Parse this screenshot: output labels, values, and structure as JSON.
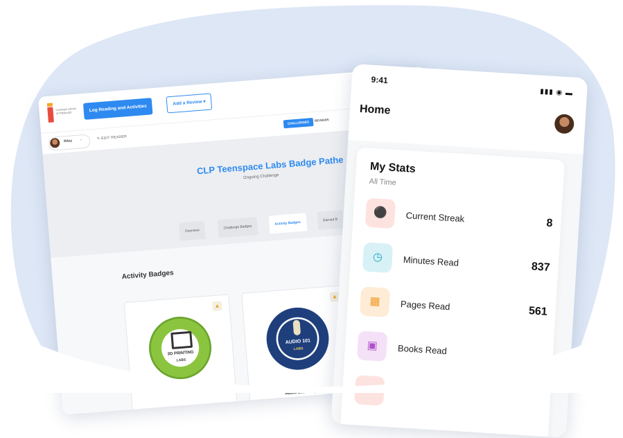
{
  "colors": {
    "background_blob": "#dde7f6",
    "accent_blue": "#2e8af0"
  },
  "desktop": {
    "logo_text": "Carnegie Library of Pittsburgh",
    "log_button": "Log Reading and Activities",
    "review_button": "Add a Review",
    "user": {
      "name": "Riley",
      "edit_label": "EDIT READER"
    },
    "nav": {
      "challenges": "CHALLENGES",
      "reviews": "REVIEWS"
    },
    "hero": {
      "title": "CLP Teenspace Labs Badge Pathe",
      "subtitle": "Ongoing Challenge"
    },
    "tabs": [
      {
        "label": "Overview"
      },
      {
        "label": "Challenge Badges"
      },
      {
        "label": "Activity Badges"
      },
      {
        "label": "Earned B"
      }
    ],
    "section_title": "Activity Badges",
    "badges": [
      {
        "inner_text": "3D PRINTING",
        "brand": "LABS",
        "label": ""
      },
      {
        "inner_text": "AUDIO 101",
        "brand": "LABS",
        "label": "Audio 101 Badge"
      }
    ]
  },
  "phone": {
    "time": "9:41",
    "status_icons": "signal wifi battery",
    "title": "Home",
    "stats": {
      "title": "My Stats",
      "subtitle": "All Time",
      "rows": [
        {
          "label": "Current Streak",
          "value": "8",
          "icon": "flame-icon",
          "bg": "#fde3df",
          "fg": "#e8553a"
        },
        {
          "label": "Minutes Read",
          "value": "837",
          "icon": "clock-icon",
          "bg": "#d8f1f6",
          "fg": "#1aa9c4"
        },
        {
          "label": "Pages Read",
          "value": "561",
          "icon": "pages-icon",
          "bg": "#feecd7",
          "fg": "#f29a27"
        },
        {
          "label": "Books Read",
          "value": "",
          "icon": "book-icon",
          "bg": "#f4e1f7",
          "fg": "#b04fc9"
        }
      ]
    }
  }
}
